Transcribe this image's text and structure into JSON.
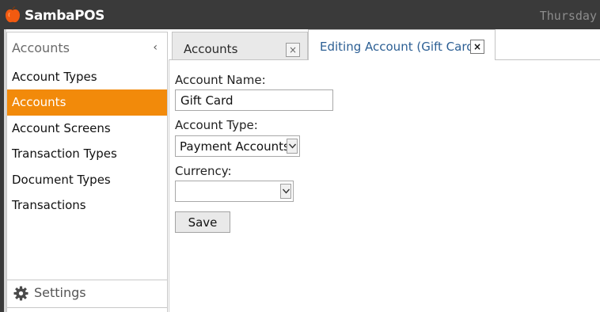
{
  "window": {
    "app_title": "SambaPOS",
    "day": "Thursday"
  },
  "sidebar": {
    "title": "Accounts",
    "collapse_glyph": "‹",
    "items": [
      {
        "label": "Account Types",
        "active": false
      },
      {
        "label": "Accounts",
        "active": true
      },
      {
        "label": "Account Screens",
        "active": false
      },
      {
        "label": "Transaction Types",
        "active": false
      },
      {
        "label": "Document Types",
        "active": false
      },
      {
        "label": "Transactions",
        "active": false
      }
    ],
    "settings_label": "Settings",
    "accent_color": "#f28a0a"
  },
  "tabs": [
    {
      "label": "Accounts",
      "active": false,
      "close": "×"
    },
    {
      "label": "Editing Account (Gift Card)",
      "active": true,
      "close": "×"
    }
  ],
  "form": {
    "account_name_label": "Account Name:",
    "account_name_value": "Gift Card",
    "account_type_label": "Account Type:",
    "account_type_value": "Payment Accounts",
    "currency_label": "Currency:",
    "currency_value": "",
    "save_label": "Save"
  },
  "icons": {
    "logo": "apple-logo-icon",
    "settings": "gear-icon",
    "dropdown": "chevron-down-icon"
  }
}
